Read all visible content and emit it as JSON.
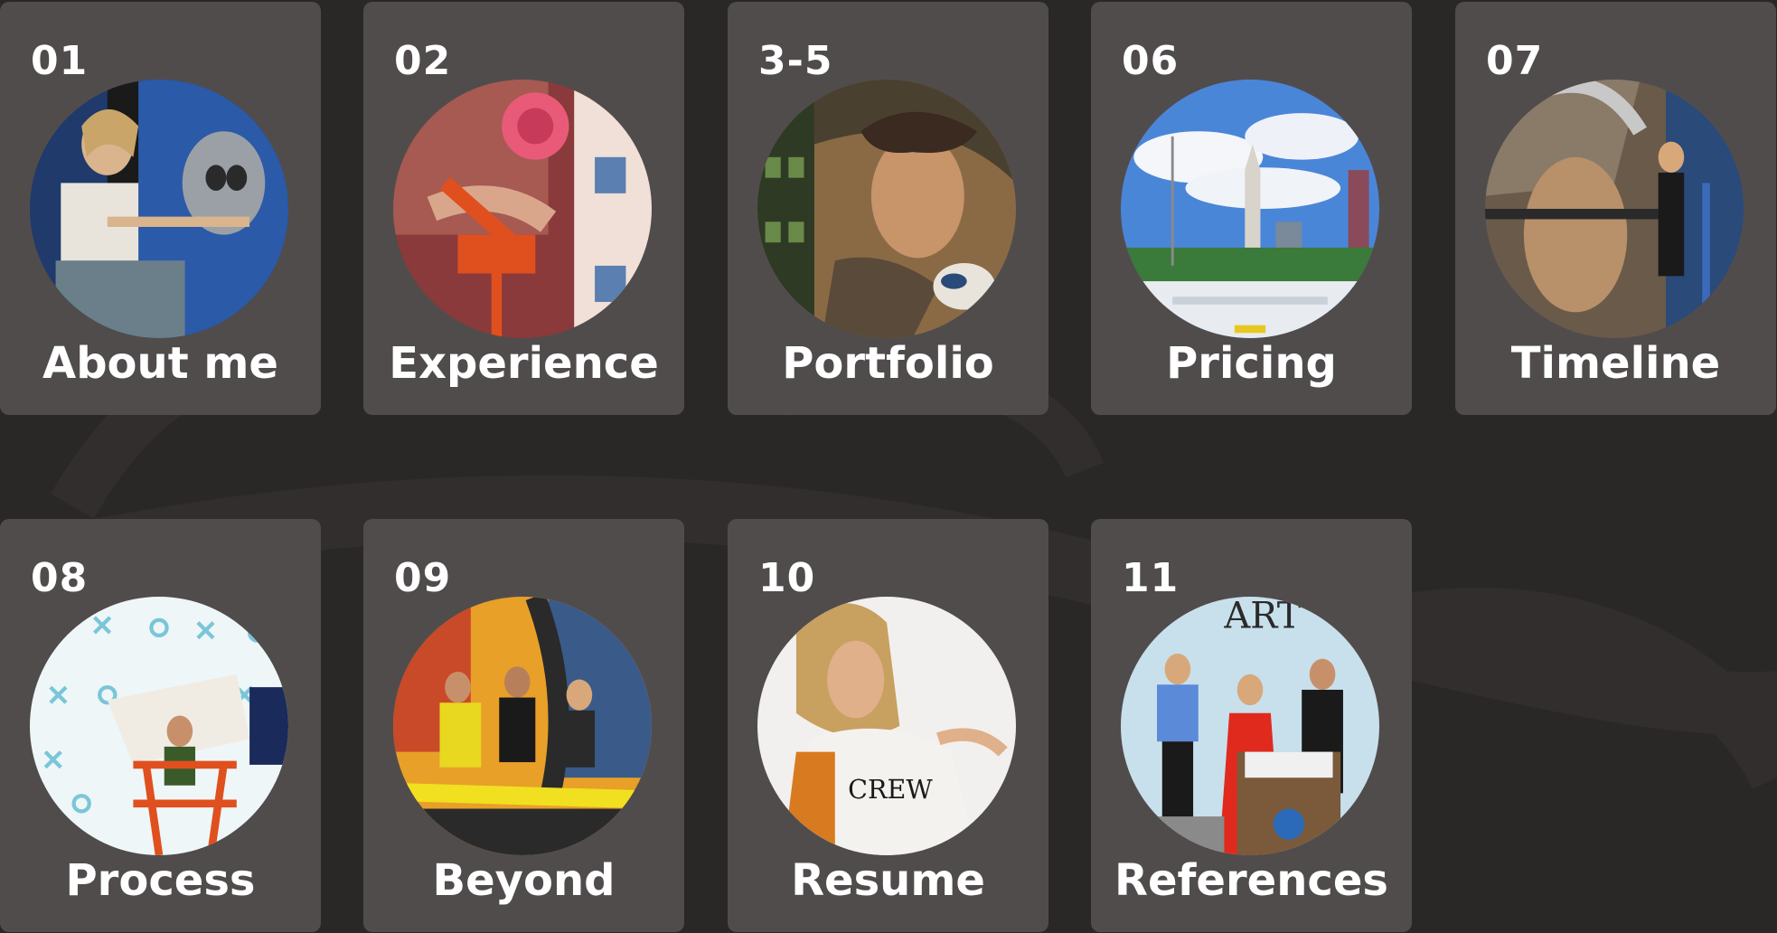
{
  "cards": [
    {
      "number": "01",
      "title": "About me",
      "image": "artist-painting-skull-mural-photo"
    },
    {
      "number": "02",
      "title": "Experience",
      "image": "lift-in-front-of-flower-mural-photo"
    },
    {
      "number": "3-5",
      "title": "Portfolio",
      "image": "woman-with-feathers-mural-photo"
    },
    {
      "number": "06",
      "title": "Pricing",
      "image": "city-skyline-plaza-photo"
    },
    {
      "number": "07",
      "title": "Timeline",
      "image": "artist-painting-face-mural-photo"
    },
    {
      "number": "08",
      "title": "Process",
      "image": "artist-on-lift-pattern-wall-photo"
    },
    {
      "number": "09",
      "title": "Beyond",
      "image": "ribbon-cutting-ceremony-photo"
    },
    {
      "number": "10",
      "title": "Resume",
      "image": "artist-portrait-photo"
    },
    {
      "number": "11",
      "title": "References",
      "image": "museum-podium-speech-photo"
    }
  ],
  "colors": {
    "background": "#2a2727",
    "card": "#514c4c",
    "text": "#ffffff"
  }
}
